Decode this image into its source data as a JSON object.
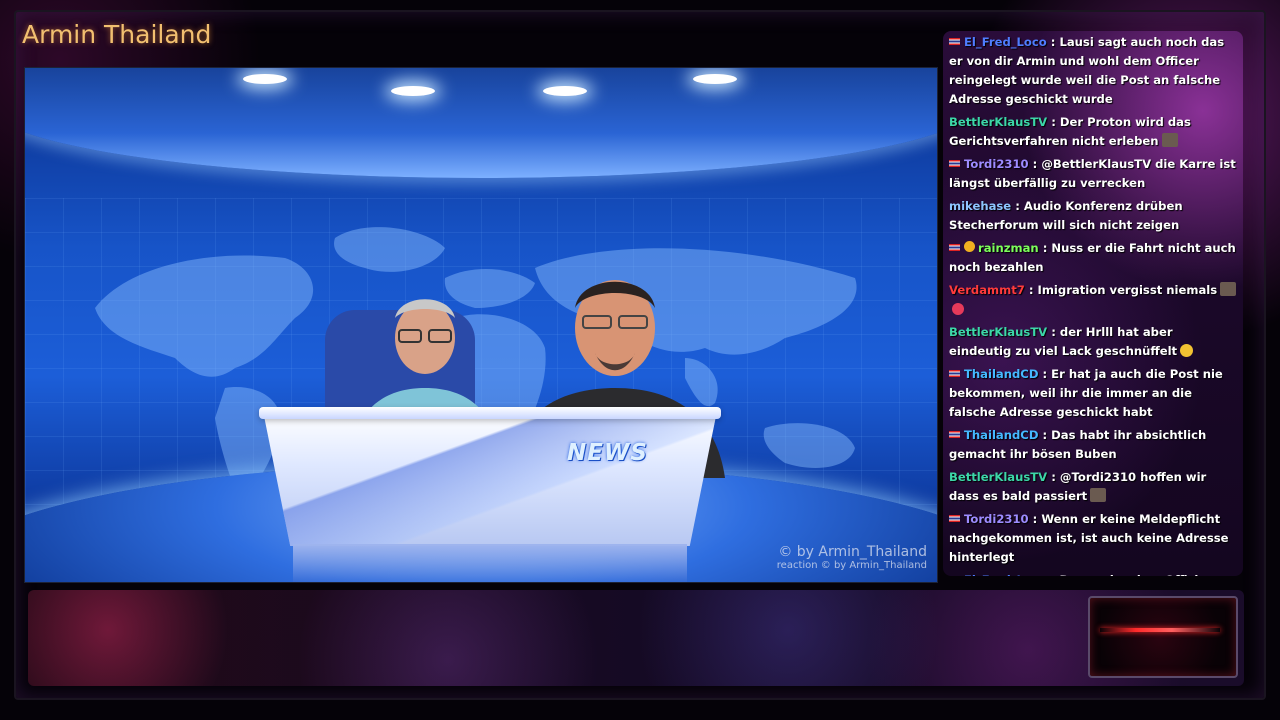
{
  "channel": {
    "title": "Armin Thailand"
  },
  "stage": {
    "desk_logo": "NEWS",
    "copyright_main": "© by Armin_Thailand",
    "copyright_sub": "reaction  © by Armin_Thailand"
  },
  "chat": {
    "messages": [
      {
        "user": "El_Fred_Loco",
        "color": "#4f7dff",
        "flag": true,
        "text": "Lausi sagt auch noch das er von dir Armin und wohl dem Officer reingelegt wurde weil die Post an falsche Adresse geschickt wurde"
      },
      {
        "user": "BettlerKlausTV",
        "color": "#3cd7a8",
        "flag": false,
        "text": "Der Proton wird das Gerichtsverfahren nicht erleben",
        "emote": "emote"
      },
      {
        "user": "Tordi2310",
        "color": "#9d8cff",
        "flag": true,
        "text": "@BettlerKlausTV die Karre ist längst überfällig zu verrecken"
      },
      {
        "user": "mikehase",
        "color": "#8ec5ff",
        "flag": false,
        "text": "Audio Konferenz drüben Stecherforum will sich nicht zeigen"
      },
      {
        "user": "rainzman",
        "color": "#7cff5a",
        "flag": true,
        "badge": true,
        "text": "Nuss er die Fahrt nicht auch noch bezahlen"
      },
      {
        "user": "Verdammt7",
        "color": "#ff3b3b",
        "flag": false,
        "text": "Imigration vergisst niemals",
        "emote": "emote",
        "emote2": "heart"
      },
      {
        "user": "BettlerKlausTV",
        "color": "#3cd7a8",
        "flag": false,
        "text": "der Hrlll hat aber eindeutig zu viel Lack geschnüffelt",
        "emote": "laugh"
      },
      {
        "user": "ThailandCD",
        "color": "#45b8ff",
        "flag": true,
        "text": "Er hat ja auch die Post nie bekommen, weil ihr die immer an die falsche Adresse geschickt habt"
      },
      {
        "user": "ThailandCD",
        "color": "#45b8ff",
        "flag": true,
        "text": "Das habt ihr absichtlich gemacht ihr bösen Buben"
      },
      {
        "user": "BettlerKlausTV",
        "color": "#3cd7a8",
        "flag": false,
        "text": "@Tordi2310 hoffen wir dass es bald passiert",
        "emote": "emote"
      },
      {
        "user": "Tordi2310",
        "color": "#9d8cff",
        "flag": true,
        "text": "Wenn er keine Meldepflicht nachgekommen ist, ist auch keine Adresse hinterlegt"
      },
      {
        "user": "El_Fred_Loco",
        "color": "#4f7dff",
        "flag": true,
        "text": "Das er das dem Offizier vorwirft ist schon krass"
      }
    ]
  }
}
